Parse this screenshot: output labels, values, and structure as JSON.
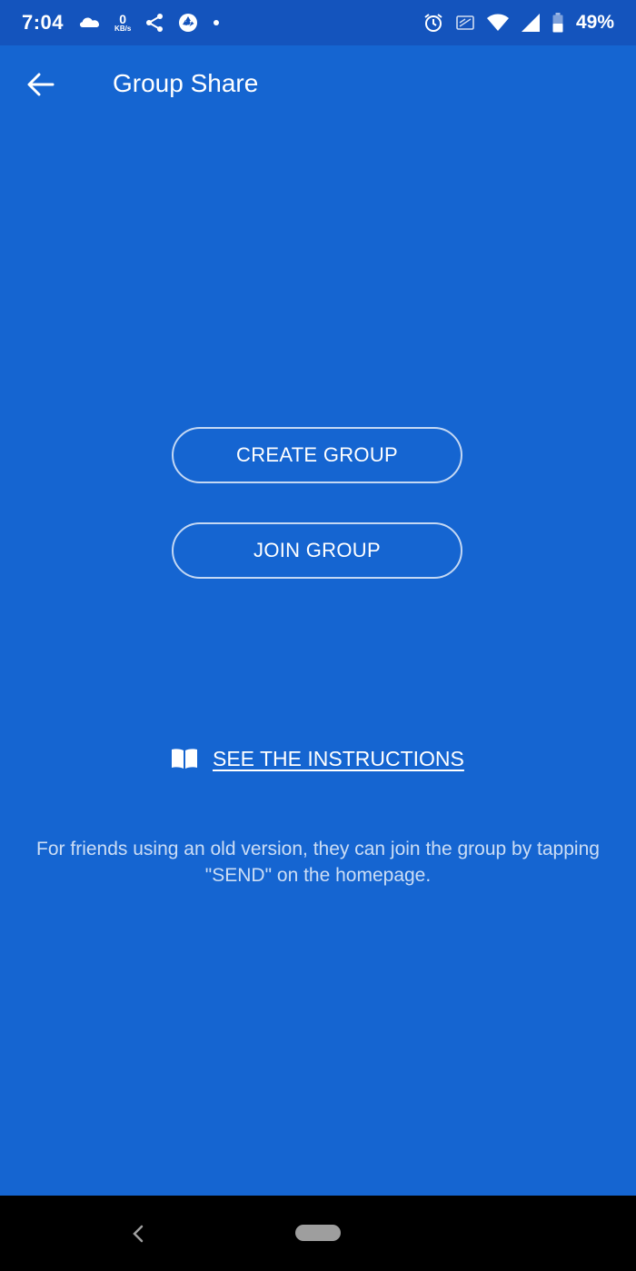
{
  "status_bar": {
    "time": "7:04",
    "data_speed_value": "0",
    "data_speed_unit": "KB/s",
    "battery_percent": "49%",
    "icons_left": [
      "weather-icon",
      "share-icon",
      "shutter-icon",
      "dot-icon"
    ],
    "icons_right": [
      "alarm-icon",
      "cast-icon",
      "wifi-icon",
      "signal-icon",
      "battery-icon"
    ]
  },
  "app_bar": {
    "title": "Group Share",
    "back_icon": "arrow-left-icon"
  },
  "actions": {
    "create_group_label": "CREATE GROUP",
    "join_group_label": "JOIN GROUP"
  },
  "instructions": {
    "icon": "book-icon",
    "label": "SEE THE INSTRUCTIONS"
  },
  "footer": {
    "note": "For friends using an old version, they can join the group by tapping \"SEND\" on the homepage."
  },
  "colors": {
    "background": "#1565d1",
    "status_bar": "#1454bd",
    "nav_bar": "#000000"
  }
}
